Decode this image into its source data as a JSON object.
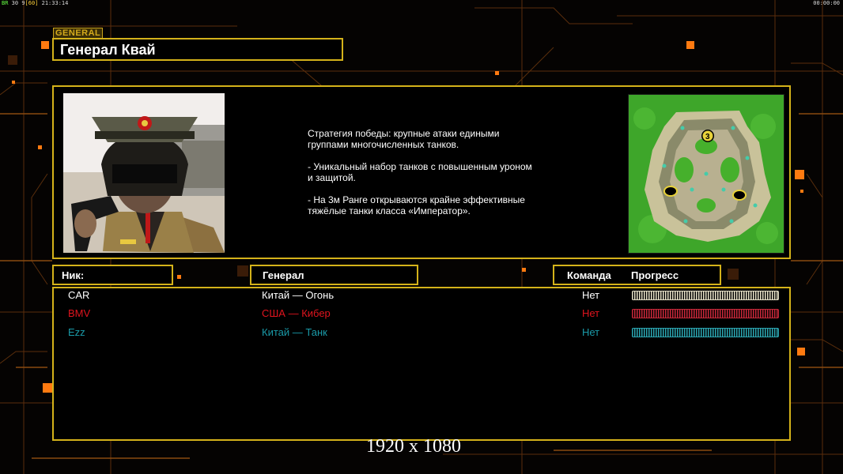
{
  "hud": {
    "fps_label": "BR",
    "fps_value": "30",
    "fps_cap_a": "9",
    "fps_cap_b": "60",
    "clock": "21:33:14",
    "timer": "00:00:00"
  },
  "header": {
    "tag": "GENERAL",
    "title": "Генерал Квай"
  },
  "description": {
    "lines": [
      "Стратегия победы: крупные атаки едиными\n группами многочисленных танков.",
      "- Уникальный набор танков с повышенным уроном\n и защитой.",
      "- На 3м Ранге открываются крайне эффективные\n тяжёлые танки класса «Император»."
    ]
  },
  "map": {
    "player_count": "3"
  },
  "table": {
    "col_nick": "Ник:",
    "col_general": "Генерал",
    "col_team": "Команда",
    "col_progress": "Прогресс",
    "rows": [
      {
        "nick": "CAR",
        "general": "Китай — Огонь",
        "team": "Нет",
        "color": "#ffffff",
        "bar_color": "#e8e2c8"
      },
      {
        "nick": "BMV",
        "general": "США — Кибер",
        "team": "Нет",
        "color": "#e0141e",
        "bar_color": "#c8283a"
      },
      {
        "nick": "Ezz",
        "general": "Китай — Танк",
        "team": "Нет",
        "color": "#1a9aa8",
        "bar_color": "#2ba6b2"
      }
    ]
  },
  "resolution": "1920 x 1080",
  "colors": {
    "accent": "#d4b21a",
    "orange": "#ff7a10",
    "grid": "#6a3a10"
  }
}
